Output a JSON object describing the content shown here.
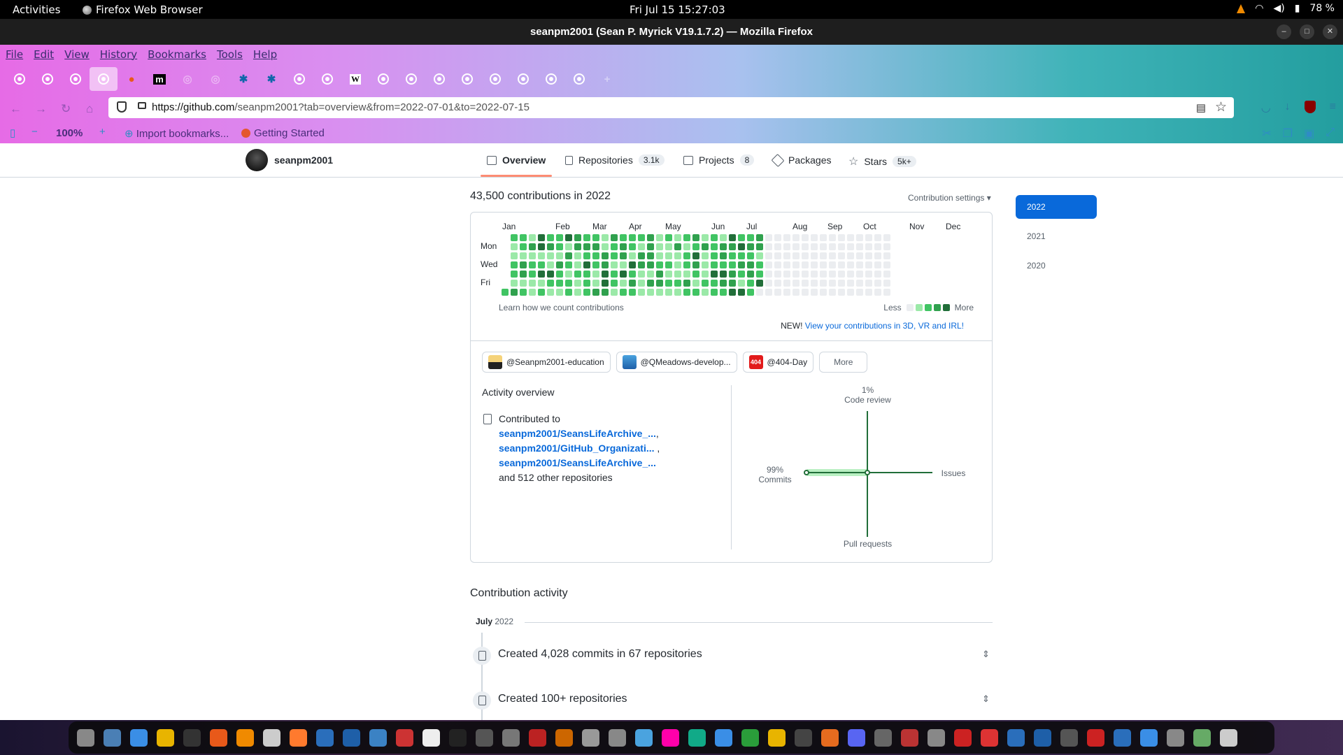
{
  "system": {
    "activities": "Activities",
    "app": "Firefox Web Browser",
    "clock": "Fri Jul 15  15:27:03",
    "battery": "78 %"
  },
  "window": {
    "title": "seanpm2001 (Sean P. Myrick V19.1.7.2) — Mozilla Firefox"
  },
  "menu": [
    "File",
    "Edit",
    "View",
    "History",
    "Bookmarks",
    "Tools",
    "Help"
  ],
  "address": {
    "host": "https://github.com",
    "path": "/seanpm2001?tab=overview&from=2022-07-01&to=2022-07-15"
  },
  "bookmarks": {
    "zoom": "100%",
    "import": "Import bookmarks...",
    "getting_started": "Getting Started"
  },
  "profile": {
    "username": "seanpm2001"
  },
  "tabs": [
    {
      "label": "Overview",
      "count": ""
    },
    {
      "label": "Repositories",
      "count": "3.1k"
    },
    {
      "label": "Projects",
      "count": "8"
    },
    {
      "label": "Packages",
      "count": ""
    },
    {
      "label": "Stars",
      "count": "5k+"
    }
  ],
  "contributions": {
    "title": "43,500 contributions in 2022",
    "settings": "Contribution settings ▾",
    "months": [
      "Jan",
      "Feb",
      "Mar",
      "Apr",
      "May",
      "Jun",
      "Jul",
      "Aug",
      "Sep",
      "Oct",
      "Nov",
      "Dec"
    ],
    "days": [
      "Mon",
      "Wed",
      "Fri"
    ],
    "learn": "Learn how we count contributions",
    "less": "Less",
    "more": "More",
    "new_label": "NEW!",
    "new_link": "View your contributions in 3D, VR and IRL!",
    "levels": [
      "#ebedf0",
      "#9be9a8",
      "#40c463",
      "#30a14e",
      "#216e39"
    ]
  },
  "orgs": [
    {
      "label": "@Seanpm2001-education"
    },
    {
      "label": "@QMeadows-develop..."
    },
    {
      "label": "@404-Day"
    },
    {
      "label": "More"
    }
  ],
  "activity": {
    "title": "Activity overview",
    "contributed_to": "Contributed to",
    "repos": [
      "seanpm2001/SeansLifeArchive_...",
      "seanpm2001/GitHub_Organizati...",
      "seanpm2001/SeansLifeArchive_..."
    ],
    "others": "and 512 other repositories",
    "code_review_pct": "1%",
    "code_review": "Code review",
    "commits_pct": "99%",
    "commits": "Commits",
    "issues": "Issues",
    "pull_requests": "Pull requests"
  },
  "contribution_activity": {
    "title": "Contribution activity",
    "month": "July",
    "year": "2022",
    "items": [
      "Created 4,028 commits in 67 repositories",
      "Created 100+ repositories"
    ]
  },
  "years": [
    "2022",
    "2021",
    "2020"
  ]
}
